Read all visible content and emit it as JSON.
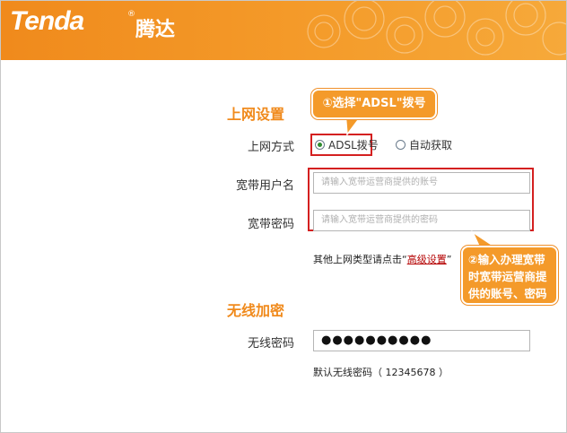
{
  "brand": {
    "logo_text": "Tenda",
    "logo_reg": "®",
    "logo_cn": "腾达"
  },
  "colors": {
    "header": "#f08a1c",
    "accent": "#f08a1c",
    "callout": "#f49a2a",
    "highlight_box": "#d42020"
  },
  "internet": {
    "section_title": "上网设置",
    "mode_label": "上网方式",
    "options": [
      {
        "label": "ADSL拨号",
        "selected": true
      },
      {
        "label": "自动获取",
        "selected": false
      }
    ],
    "username_label": "宽带用户名",
    "username_placeholder": "请输入宽带运营商提供的账号",
    "password_label": "宽带密码",
    "password_placeholder": "请输入宽带运营商提供的密码",
    "other_prefix": "其他上网类型请点击“",
    "other_link": "高级设置",
    "other_suffix": "”"
  },
  "callouts": {
    "step1": "①选择\"ADSL\"拨号",
    "step2_lines": [
      "②输入办理宽带",
      "时宽带运营商提",
      "供的账号、密码"
    ]
  },
  "wireless": {
    "section_title": "无线加密",
    "password_label": "无线密码",
    "password_value": "●●●●●●●●●●",
    "default_hint": "默认无线密码（ 12345678 ）"
  }
}
